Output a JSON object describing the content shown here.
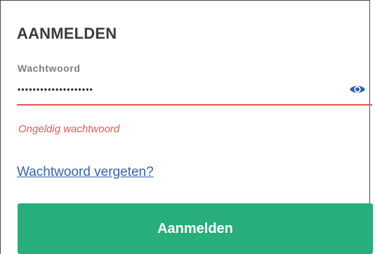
{
  "form": {
    "title": "AANMELDEN",
    "password_label": "Wachtwoord",
    "password_value": "••••••••••••••••••••",
    "password_toggle_icon": "eye-icon",
    "error_message": "Ongeldig wachtwoord",
    "forgot_link": "Wachtwoord vergeten?",
    "submit_label": "Aanmelden"
  },
  "colors": {
    "accent_green": "#27ae7a",
    "error_red": "#e2574c",
    "link_blue": "#3464b4",
    "eye_blue": "#2f5fb3"
  }
}
